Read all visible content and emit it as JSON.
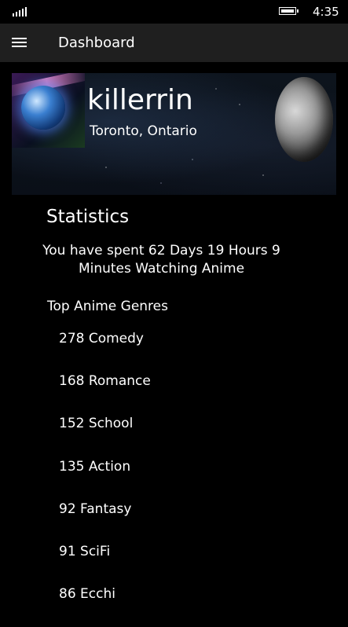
{
  "status_bar": {
    "signal_icon": "signal-bars-icon",
    "battery_icon": "battery-icon",
    "time": "4:35"
  },
  "app_bar": {
    "menu_icon": "hamburger-menu-icon",
    "title": "Dashboard"
  },
  "profile": {
    "username": "killerrin",
    "location": "Toronto, Ontario"
  },
  "statistics": {
    "heading": "Statistics",
    "time_spent": "You have spent  62 Days 19 Hours 9 Minutes Watching Anime",
    "genres_heading": "Top Anime Genres",
    "genres": [
      {
        "label": "278 Comedy"
      },
      {
        "label": "168 Romance"
      },
      {
        "label": "152 School"
      },
      {
        "label": "135 Action"
      },
      {
        "label": "92 Fantasy"
      },
      {
        "label": "91 SciFi"
      },
      {
        "label": "86 Ecchi"
      }
    ]
  }
}
